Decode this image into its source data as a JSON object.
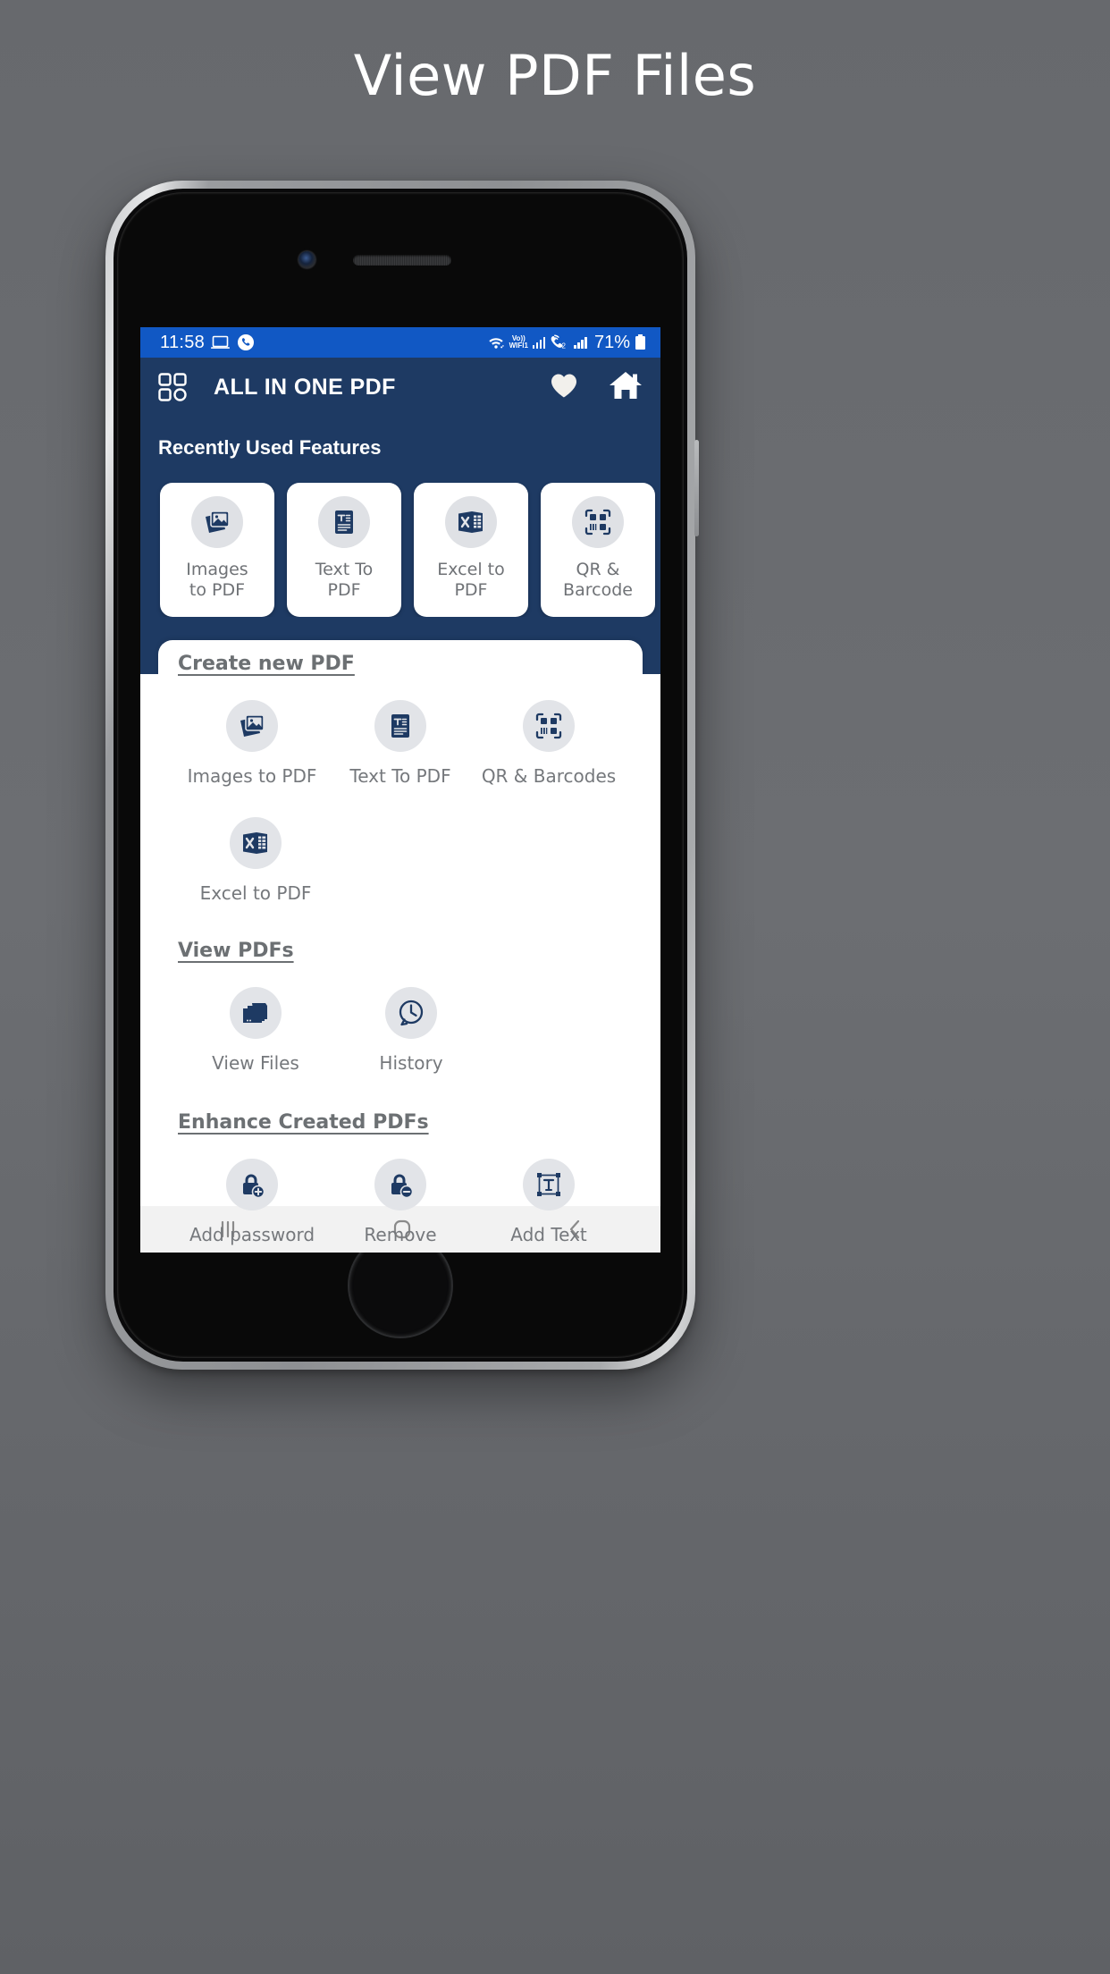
{
  "headline": "View PDF Files",
  "statusbar": {
    "time": "11:58",
    "battery": "71%",
    "volte_line1": "Vo))",
    "volte_line2": "WIFI1",
    "sim2_label": "2",
    "icons": [
      "laptop-icon",
      "call-icon",
      "wifi-icon",
      "volte-icon",
      "signal-bars-icon",
      "call-sim2-icon",
      "signal-bars-2-icon",
      "battery-icon"
    ]
  },
  "appbar": {
    "title": "ALL IN ONE PDF",
    "grid_icon": "grid-menu-icon",
    "favorite_icon": "heart-icon",
    "home_icon": "home-icon"
  },
  "recent": {
    "title": "Recently Used Features",
    "cards": [
      {
        "label": "Images\nto PDF",
        "line1": "Images",
        "line2": "to PDF",
        "icon": "images-icon"
      },
      {
        "label": "Text To\nPDF",
        "line1": "Text To",
        "line2": "PDF",
        "icon": "text-doc-icon"
      },
      {
        "label": "Excel to\nPDF",
        "line1": "Excel to",
        "line2": "PDF",
        "icon": "excel-icon"
      },
      {
        "label": "QR &\nBarcode",
        "line1": "QR &",
        "line2": "Barcode",
        "icon": "qr-barcode-icon"
      }
    ]
  },
  "sections": [
    {
      "title": "Create new PDF",
      "rows": [
        [
          {
            "label": "Images to PDF",
            "icon": "images-icon"
          },
          {
            "label": "Text To PDF",
            "icon": "text-doc-icon"
          },
          {
            "label": "QR & Barcodes",
            "icon": "qr-barcode-icon"
          }
        ],
        [
          {
            "label": "Excel to PDF",
            "icon": "excel-icon"
          }
        ]
      ]
    },
    {
      "title": "View PDFs",
      "rows": [
        [
          {
            "label": "View Files",
            "icon": "folders-icon"
          },
          {
            "label": "History",
            "icon": "history-clock-icon"
          }
        ]
      ]
    },
    {
      "title": "Enhance Created PDFs",
      "rows": [
        [
          {
            "label": "Add password",
            "icon": "lock-add-icon"
          },
          {
            "label": "Remove",
            "icon": "lock-remove-icon"
          },
          {
            "label": "Add Text",
            "icon": "add-text-icon"
          }
        ]
      ]
    }
  ],
  "navbar": {
    "recents": "recents-icon",
    "home": "home-square-icon",
    "back": "back-chevron-icon"
  },
  "colors": {
    "status_blue": "#1158c4",
    "header_navy": "#1e3a63",
    "icon_navy": "#1e3a63",
    "backdrop_gray": "#6a6c70",
    "label_gray": "#75787c",
    "chip_gray": "#e2e4e8"
  }
}
